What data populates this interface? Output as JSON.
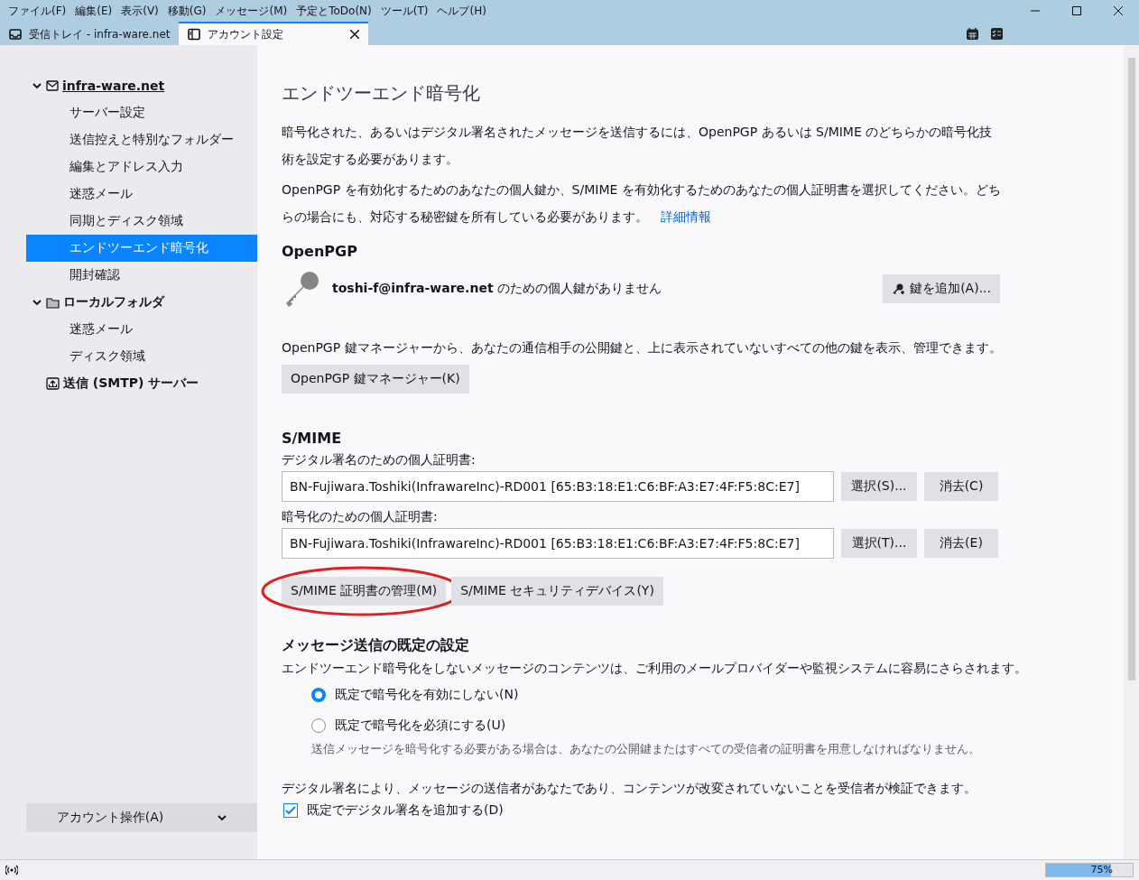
{
  "menu": [
    "ファイル(F)",
    "編集(E)",
    "表示(V)",
    "移動(G)",
    "メッセージ(M)",
    "予定とToDo(N)",
    "ツール(T)",
    "ヘルプ(H)"
  ],
  "tabs": [
    {
      "label": "受信トレイ - infra-ware.net",
      "kind": "mail",
      "selected": false
    },
    {
      "label": "アカウント設定",
      "kind": "settings",
      "selected": true
    }
  ],
  "sidebar": {
    "items": [
      {
        "label": "infra-ware.net",
        "kind": "account",
        "expanded": true,
        "selected": false,
        "children": [
          {
            "label": "サーバー設定",
            "selected": false
          },
          {
            "label": "送信控えと特別なフォルダー",
            "selected": false
          },
          {
            "label": "編集とアドレス入力",
            "selected": false
          },
          {
            "label": "迷惑メール",
            "selected": false
          },
          {
            "label": "同期とディスク領域",
            "selected": false
          },
          {
            "label": "エンドツーエンド暗号化",
            "selected": true
          },
          {
            "label": "開封確認",
            "selected": false
          }
        ]
      },
      {
        "label": "ローカルフォルダ",
        "kind": "folder",
        "expanded": true,
        "selected": false,
        "children": [
          {
            "label": "迷惑メール",
            "selected": false
          },
          {
            "label": "ディスク領域",
            "selected": false
          }
        ]
      },
      {
        "label": "送信 (SMTP) サーバー",
        "kind": "outbox",
        "selected": false
      }
    ],
    "account_actions": "アカウント操作(A)"
  },
  "page": {
    "title": "エンドツーエンド暗号化",
    "intro": [
      "暗号化された、あるいはデジタル署名されたメッセージを送信するには、OpenPGP あるいは S/MIME のどちらかの暗号化技術を設定する必要があります。",
      "OpenPGP を有効化するためのあなたの個人鍵か、S/MIME を有効化するためのあなたの個人証明書を選択してください。どちらの場合にも、対応する秘密鍵を所有している必要があります。"
    ],
    "more_info_link": "詳細情報",
    "openpgp": {
      "heading": "OpenPGP",
      "no_key_address": "toshi-f@infra-ware.net",
      "no_key_text": " のための個人鍵がありません",
      "add_key_button": "鍵を追加(A)...",
      "manager_note": "OpenPGP 鍵マネージャーから、あなたの通信相手の公開鍵と、上に表示されていないすべての他の鍵を表示、管理できます。",
      "manager_button": "OpenPGP 鍵マネージャー(K)"
    },
    "smime": {
      "heading": "S/MIME",
      "certs": [
        {
          "label": "デジタル署名のための個人証明書:",
          "value": "BN-Fujiwara.Toshiki(InfrawareInc)-RD001 [65:B3:18:E1:C6:BF:A3:E7:4F:F5:8C:E7]",
          "select_button": "選択(S)...",
          "clear_button": "消去(C)"
        },
        {
          "label": "暗号化のための個人証明書:",
          "value": "BN-Fujiwara.Toshiki(InfrawareInc)-RD001 [65:B3:18:E1:C6:BF:A3:E7:4F:F5:8C:E7]",
          "select_button": "選択(T)...",
          "clear_button": "消去(E)"
        }
      ],
      "buttons": [
        {
          "label": "S/MIME 証明書の管理(M)",
          "circled": true
        },
        {
          "label": "S/MIME セキュリティデバイス(Y)",
          "circled": false
        }
      ]
    },
    "defaults": {
      "heading": "メッセージ送信の既定の設定",
      "note": "エンドツーエンド暗号化をしないメッセージのコンテンツは、ご利用のメールプロバイダーや監視システムに容易にさらされます。",
      "radios": [
        {
          "label": "既定で暗号化を有効にしない(N)",
          "selected": true
        },
        {
          "label": "既定で暗号化を必須にする(U)",
          "selected": false
        }
      ],
      "radio_hint": "送信メッセージを暗号化する必要がある場合は、あなたの公開鍵またはすべての受信者の証明書を用意しなければなりません。",
      "signature_note": "デジタル署名により、メッセージの送信者があなたであり、コンテンツが改変されていないことを受信者が検証できます。",
      "signature_checkbox": {
        "label": "既定でデジタル署名を追加する(D)",
        "checked": true
      }
    }
  },
  "status_bar": {
    "progress": {
      "level": 0.75,
      "reading": "75%"
    }
  }
}
